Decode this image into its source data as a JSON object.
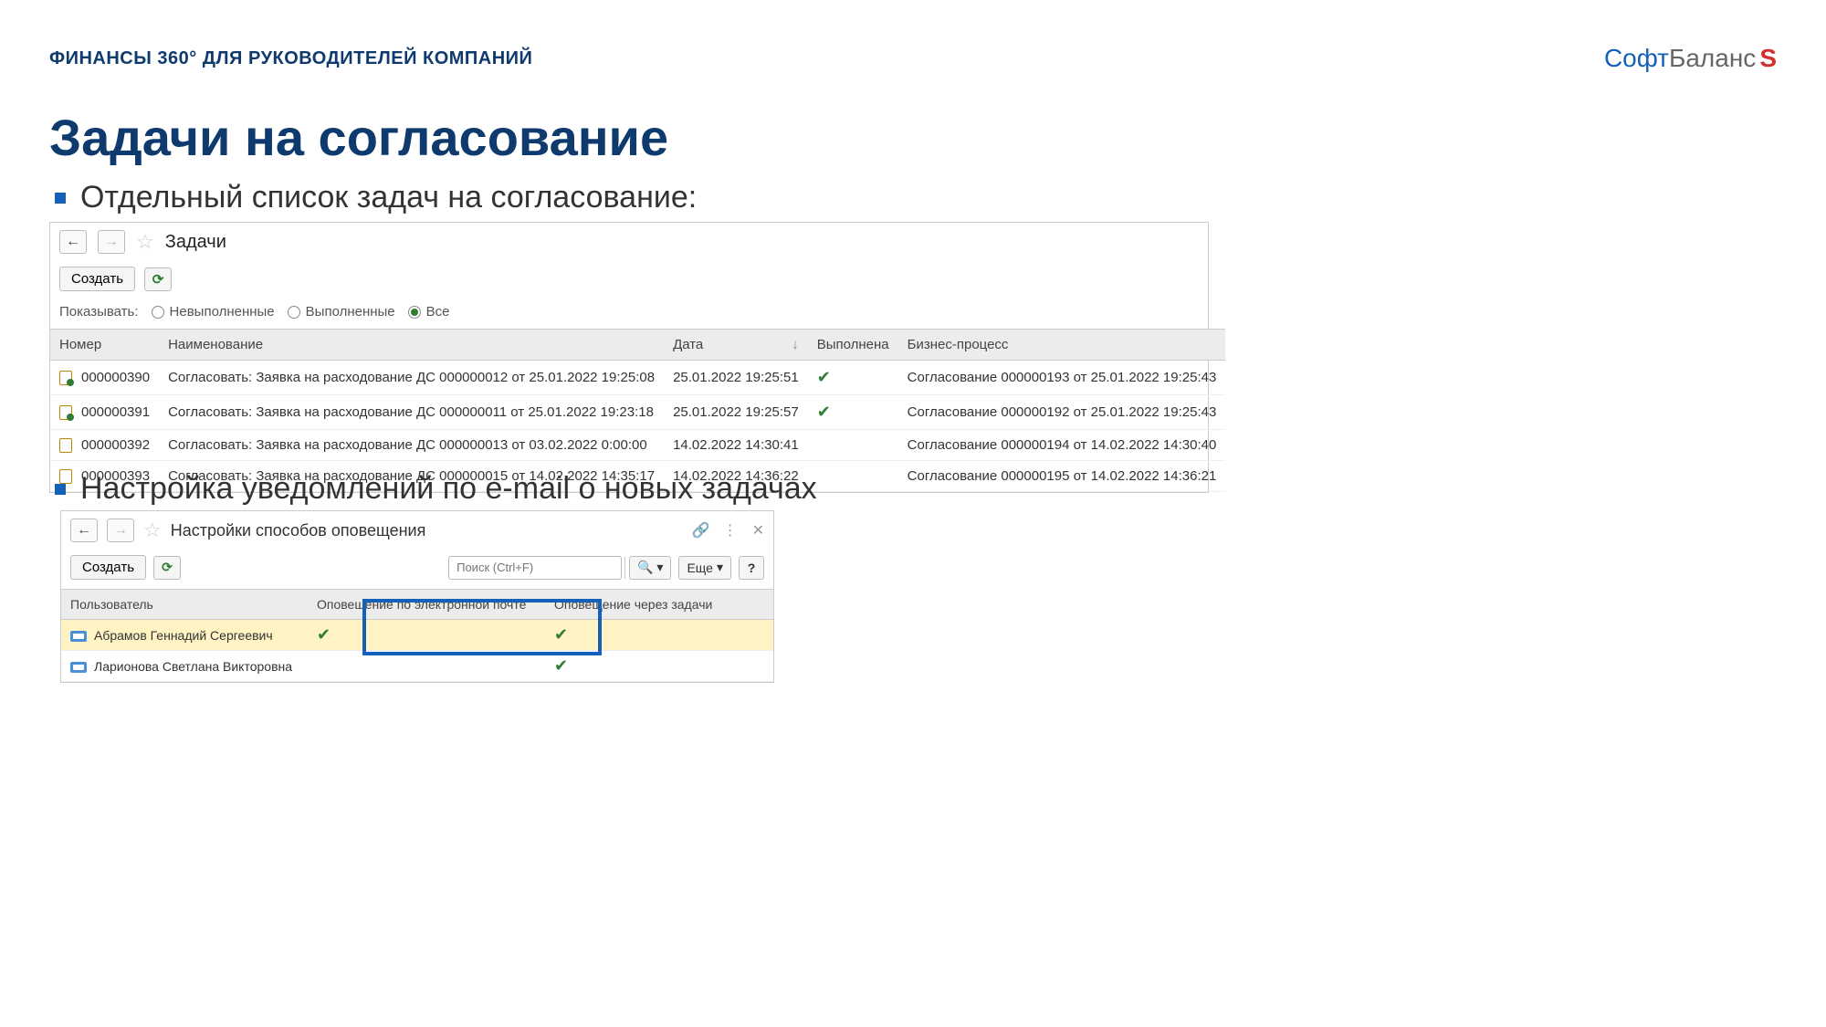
{
  "header": {
    "breadcrumb": "ФИНАНСЫ 360° ДЛЯ РУКОВОДИТЕЛЕЙ КОМПАНИЙ",
    "logo_part1": "Софт",
    "logo_part2": "Баланс",
    "logo_mark": "S"
  },
  "title": "Задачи на согласование",
  "bullet1": "Отдельный список задач на согласование:",
  "bullet2": "Настройка уведомлений по e-mail о новых задачах",
  "panel1": {
    "title": "Задачи",
    "create": "Создать",
    "show_label": "Показывать:",
    "filter_unfinished": "Невыполненные",
    "filter_finished": "Выполненные",
    "filter_all": "Все",
    "cols": {
      "num": "Номер",
      "name": "Наименование",
      "date": "Дата",
      "done": "Выполнена",
      "process": "Бизнес-процесс"
    },
    "rows": [
      {
        "num": "000000390",
        "name": "Согласовать: Заявка на расходование ДС 000000012 от 25.01.2022 19:25:08",
        "date": "25.01.2022 19:25:51",
        "done": true,
        "process": "Согласование 000000193 от 25.01.2022 19:25:43"
      },
      {
        "num": "000000391",
        "name": "Согласовать: Заявка на расходование ДС 000000011 от 25.01.2022 19:23:18",
        "date": "25.01.2022 19:25:57",
        "done": true,
        "process": "Согласование 000000192 от 25.01.2022 19:25:43"
      },
      {
        "num": "000000392",
        "name": "Согласовать: Заявка на расходование ДС 000000013 от 03.02.2022 0:00:00",
        "date": "14.02.2022 14:30:41",
        "done": false,
        "process": "Согласование 000000194 от 14.02.2022 14:30:40"
      },
      {
        "num": "000000393",
        "name": "Согласовать: Заявка на расходование ДС 000000015 от 14.02.2022 14:35:17",
        "date": "14.02.2022 14:36:22",
        "done": false,
        "process": "Согласование 000000195 от 14.02.2022 14:36:21"
      }
    ]
  },
  "panel2": {
    "title": "Настройки способов оповещения",
    "create": "Создать",
    "search_placeholder": "Поиск (Ctrl+F)",
    "more": "Еще",
    "help": "?",
    "cols": {
      "user": "Пользователь",
      "email": "Оповещение по электронной почте",
      "tasks": "Оповещение через задачи"
    },
    "rows": [
      {
        "user": "Абрамов Геннадий Сергеевич",
        "email": true,
        "tasks": true,
        "selected": true
      },
      {
        "user": "Ларионова Светлана Викторовна",
        "email": false,
        "tasks": true,
        "selected": false
      }
    ]
  }
}
